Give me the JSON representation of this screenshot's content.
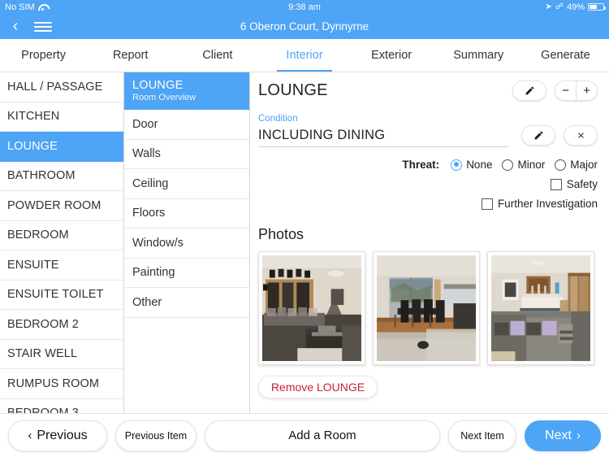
{
  "status_bar": {
    "carrier": "No SIM",
    "wifi_icon": "wifi-icon",
    "time": "9:38 am",
    "location_icon": "location-arrow-icon",
    "bluetooth_icon": "bluetooth-icon",
    "battery_percent": "49%"
  },
  "nav": {
    "back_icon": "chevron-left-icon",
    "menu_icon": "hamburger-menu-icon",
    "title": "6 Oberon Court, Dynnyrne"
  },
  "tabs": [
    {
      "label": "Property",
      "active": false
    },
    {
      "label": "Report",
      "active": false
    },
    {
      "label": "Client",
      "active": false
    },
    {
      "label": "Interior",
      "active": true
    },
    {
      "label": "Exterior",
      "active": false
    },
    {
      "label": "Summary",
      "active": false
    },
    {
      "label": "Generate",
      "active": false
    }
  ],
  "rooms": [
    {
      "label": "HALL / PASSAGE",
      "selected": false
    },
    {
      "label": "KITCHEN",
      "selected": false
    },
    {
      "label": "LOUNGE",
      "selected": true
    },
    {
      "label": "BATHROOM",
      "selected": false
    },
    {
      "label": "POWDER ROOM",
      "selected": false
    },
    {
      "label": "BEDROOM",
      "selected": false
    },
    {
      "label": "ENSUITE",
      "selected": false
    },
    {
      "label": "ENSUITE TOILET",
      "selected": false
    },
    {
      "label": "BEDROOM 2",
      "selected": false
    },
    {
      "label": "STAIR WELL",
      "selected": false
    },
    {
      "label": "RUMPUS ROOM",
      "selected": false
    },
    {
      "label": "BEDROOM 3",
      "selected": false
    }
  ],
  "items": {
    "header": {
      "title": "LOUNGE",
      "subtitle": "Room Overview"
    },
    "list": [
      {
        "label": "Door"
      },
      {
        "label": "Walls"
      },
      {
        "label": "Ceiling"
      },
      {
        "label": "Floors"
      },
      {
        "label": "Window/s"
      },
      {
        "label": "Painting"
      },
      {
        "label": "Other"
      }
    ]
  },
  "detail": {
    "title": "LOUNGE",
    "edit_icon": "pencil-icon",
    "stepper_minus": "−",
    "stepper_plus": "+",
    "condition_label": "Condition",
    "condition_value": "INCLUDING DINING",
    "condition_edit_icon": "pencil-icon",
    "condition_clear_icon": "close-x-icon",
    "threat_label": "Threat:",
    "threat_options": [
      {
        "label": "None",
        "selected": true
      },
      {
        "label": "Minor",
        "selected": false
      },
      {
        "label": "Major",
        "selected": false
      }
    ],
    "checkboxes": [
      {
        "label": "Safety",
        "checked": false
      },
      {
        "label": "Further Investigation",
        "checked": false
      }
    ],
    "photos_title": "Photos",
    "photos": [
      {
        "alt": "Lounge with dark grey sectional sofa, timber shelving and glass coffee table"
      },
      {
        "alt": "Dining area with black chairs and sliding glass doors to outdoors"
      },
      {
        "alt": "Lounge with grey sofa, lilac cushions and timber bar cabinetry"
      }
    ],
    "remove_button": "Remove LOUNGE"
  },
  "bottom_bar": {
    "previous": "Previous",
    "previous_chevron": "‹",
    "previous_item": "Previous Item",
    "add_room": "Add a Room",
    "next_item": "Next Item",
    "next": "Next",
    "next_chevron": "›"
  },
  "colors": {
    "accent_blue": "#4EA4F5",
    "remove_red": "#C62238"
  }
}
